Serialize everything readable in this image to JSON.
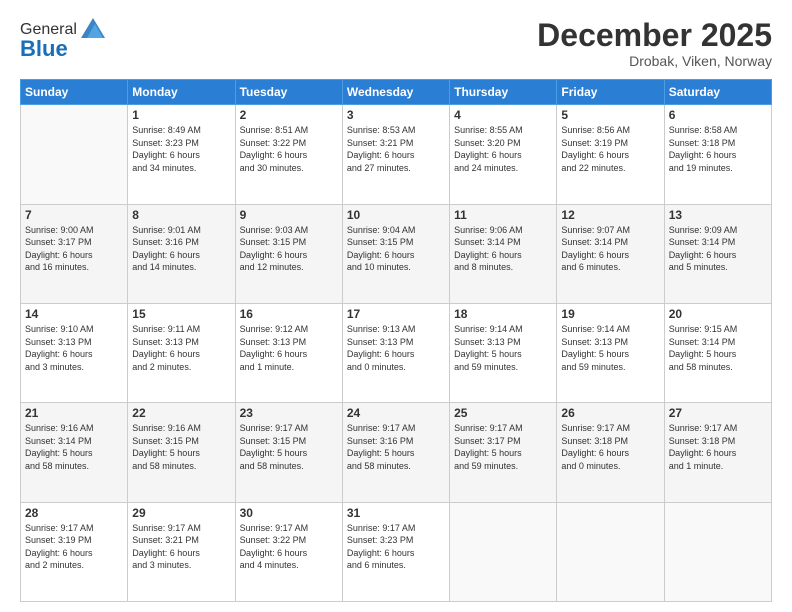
{
  "logo": {
    "general": "General",
    "blue": "Blue"
  },
  "header": {
    "month": "December 2025",
    "location": "Drobak, Viken, Norway"
  },
  "weekdays": [
    "Sunday",
    "Monday",
    "Tuesday",
    "Wednesday",
    "Thursday",
    "Friday",
    "Saturday"
  ],
  "weeks": [
    [
      {
        "day": "",
        "info": ""
      },
      {
        "day": "1",
        "info": "Sunrise: 8:49 AM\nSunset: 3:23 PM\nDaylight: 6 hours\nand 34 minutes."
      },
      {
        "day": "2",
        "info": "Sunrise: 8:51 AM\nSunset: 3:22 PM\nDaylight: 6 hours\nand 30 minutes."
      },
      {
        "day": "3",
        "info": "Sunrise: 8:53 AM\nSunset: 3:21 PM\nDaylight: 6 hours\nand 27 minutes."
      },
      {
        "day": "4",
        "info": "Sunrise: 8:55 AM\nSunset: 3:20 PM\nDaylight: 6 hours\nand 24 minutes."
      },
      {
        "day": "5",
        "info": "Sunrise: 8:56 AM\nSunset: 3:19 PM\nDaylight: 6 hours\nand 22 minutes."
      },
      {
        "day": "6",
        "info": "Sunrise: 8:58 AM\nSunset: 3:18 PM\nDaylight: 6 hours\nand 19 minutes."
      }
    ],
    [
      {
        "day": "7",
        "info": "Sunrise: 9:00 AM\nSunset: 3:17 PM\nDaylight: 6 hours\nand 16 minutes."
      },
      {
        "day": "8",
        "info": "Sunrise: 9:01 AM\nSunset: 3:16 PM\nDaylight: 6 hours\nand 14 minutes."
      },
      {
        "day": "9",
        "info": "Sunrise: 9:03 AM\nSunset: 3:15 PM\nDaylight: 6 hours\nand 12 minutes."
      },
      {
        "day": "10",
        "info": "Sunrise: 9:04 AM\nSunset: 3:15 PM\nDaylight: 6 hours\nand 10 minutes."
      },
      {
        "day": "11",
        "info": "Sunrise: 9:06 AM\nSunset: 3:14 PM\nDaylight: 6 hours\nand 8 minutes."
      },
      {
        "day": "12",
        "info": "Sunrise: 9:07 AM\nSunset: 3:14 PM\nDaylight: 6 hours\nand 6 minutes."
      },
      {
        "day": "13",
        "info": "Sunrise: 9:09 AM\nSunset: 3:14 PM\nDaylight: 6 hours\nand 5 minutes."
      }
    ],
    [
      {
        "day": "14",
        "info": "Sunrise: 9:10 AM\nSunset: 3:13 PM\nDaylight: 6 hours\nand 3 minutes."
      },
      {
        "day": "15",
        "info": "Sunrise: 9:11 AM\nSunset: 3:13 PM\nDaylight: 6 hours\nand 2 minutes."
      },
      {
        "day": "16",
        "info": "Sunrise: 9:12 AM\nSunset: 3:13 PM\nDaylight: 6 hours\nand 1 minute."
      },
      {
        "day": "17",
        "info": "Sunrise: 9:13 AM\nSunset: 3:13 PM\nDaylight: 6 hours\nand 0 minutes."
      },
      {
        "day": "18",
        "info": "Sunrise: 9:14 AM\nSunset: 3:13 PM\nDaylight: 5 hours\nand 59 minutes."
      },
      {
        "day": "19",
        "info": "Sunrise: 9:14 AM\nSunset: 3:13 PM\nDaylight: 5 hours\nand 59 minutes."
      },
      {
        "day": "20",
        "info": "Sunrise: 9:15 AM\nSunset: 3:14 PM\nDaylight: 5 hours\nand 58 minutes."
      }
    ],
    [
      {
        "day": "21",
        "info": "Sunrise: 9:16 AM\nSunset: 3:14 PM\nDaylight: 5 hours\nand 58 minutes."
      },
      {
        "day": "22",
        "info": "Sunrise: 9:16 AM\nSunset: 3:15 PM\nDaylight: 5 hours\nand 58 minutes."
      },
      {
        "day": "23",
        "info": "Sunrise: 9:17 AM\nSunset: 3:15 PM\nDaylight: 5 hours\nand 58 minutes."
      },
      {
        "day": "24",
        "info": "Sunrise: 9:17 AM\nSunset: 3:16 PM\nDaylight: 5 hours\nand 58 minutes."
      },
      {
        "day": "25",
        "info": "Sunrise: 9:17 AM\nSunset: 3:17 PM\nDaylight: 5 hours\nand 59 minutes."
      },
      {
        "day": "26",
        "info": "Sunrise: 9:17 AM\nSunset: 3:18 PM\nDaylight: 6 hours\nand 0 minutes."
      },
      {
        "day": "27",
        "info": "Sunrise: 9:17 AM\nSunset: 3:18 PM\nDaylight: 6 hours\nand 1 minute."
      }
    ],
    [
      {
        "day": "28",
        "info": "Sunrise: 9:17 AM\nSunset: 3:19 PM\nDaylight: 6 hours\nand 2 minutes."
      },
      {
        "day": "29",
        "info": "Sunrise: 9:17 AM\nSunset: 3:21 PM\nDaylight: 6 hours\nand 3 minutes."
      },
      {
        "day": "30",
        "info": "Sunrise: 9:17 AM\nSunset: 3:22 PM\nDaylight: 6 hours\nand 4 minutes."
      },
      {
        "day": "31",
        "info": "Sunrise: 9:17 AM\nSunset: 3:23 PM\nDaylight: 6 hours\nand 6 minutes."
      },
      {
        "day": "",
        "info": ""
      },
      {
        "day": "",
        "info": ""
      },
      {
        "day": "",
        "info": ""
      }
    ]
  ]
}
